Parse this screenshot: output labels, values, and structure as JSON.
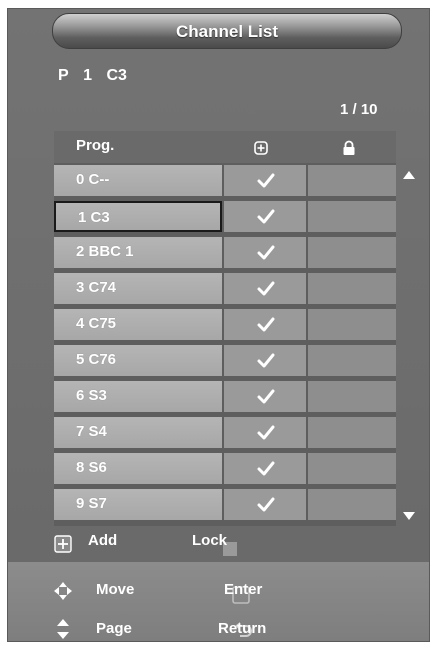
{
  "title": "Channel List",
  "current_channel": {
    "prefix": "P",
    "number": "1",
    "name": "C3"
  },
  "page_indicator": "1 / 10",
  "table": {
    "header_prog": "Prog.",
    "header_add_icon": "add-icon",
    "header_lock_icon": "lock-icon",
    "rows": [
      {
        "number": "0",
        "name": "C--",
        "added": true,
        "locked": false,
        "selected": false
      },
      {
        "number": "1",
        "name": "C3",
        "added": true,
        "locked": false,
        "selected": true
      },
      {
        "number": "2",
        "name": "BBC 1",
        "added": true,
        "locked": false,
        "selected": false
      },
      {
        "number": "3",
        "name": "C74",
        "added": true,
        "locked": false,
        "selected": false
      },
      {
        "number": "4",
        "name": "C75",
        "added": true,
        "locked": false,
        "selected": false
      },
      {
        "number": "5",
        "name": "C76",
        "added": true,
        "locked": false,
        "selected": false
      },
      {
        "number": "6",
        "name": "S3",
        "added": true,
        "locked": false,
        "selected": false
      },
      {
        "number": "7",
        "name": "S4",
        "added": true,
        "locked": false,
        "selected": false
      },
      {
        "number": "8",
        "name": "S6",
        "added": true,
        "locked": false,
        "selected": false
      },
      {
        "number": "9",
        "name": "S7",
        "added": true,
        "locked": false,
        "selected": false
      }
    ]
  },
  "legend": {
    "add_label": "Add",
    "lock_label": "Lock"
  },
  "hints": {
    "move": "Move",
    "enter": "Enter",
    "page": "Page",
    "return": "Return"
  },
  "colors": {
    "background": "#737373",
    "row_name": "#b0b0b0",
    "row_add": "#9a9a9a",
    "row_lock": "#8e8e8e",
    "text": "#ffffff"
  }
}
